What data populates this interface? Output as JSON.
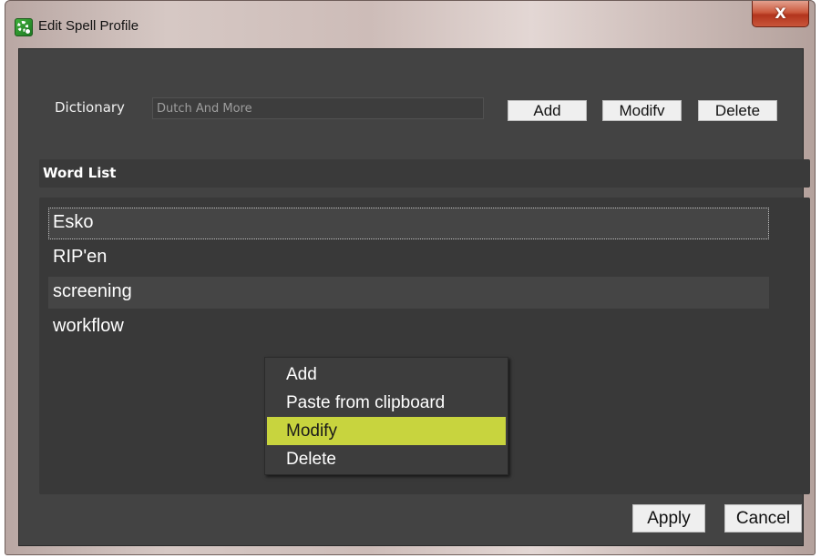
{
  "window": {
    "title": "Edit Spell Profile",
    "close_label": "X"
  },
  "dictionary": {
    "label": "Dictionary",
    "value": "Dutch And More"
  },
  "dictionary_buttons": {
    "add": "Add",
    "modify": "Modifv",
    "delete": "Delete"
  },
  "word_list": {
    "header": "Word List",
    "items": [
      "Esko",
      "RIP'en",
      "screening",
      "workflow"
    ],
    "focused_index": 0
  },
  "context_menu": {
    "items": [
      "Add",
      "Paste from clipboard",
      "Modify",
      "Delete"
    ],
    "highlighted_index": 2,
    "highlight_color": "#c8d43e"
  },
  "footer": {
    "apply": "Apply",
    "cancel": "Cancel"
  },
  "colors": {
    "panel_background": "#434343",
    "list_background": "#393939",
    "close_button": "#c84f35"
  },
  "icons": {
    "app": "green-gear-icon",
    "close": "close-icon"
  }
}
